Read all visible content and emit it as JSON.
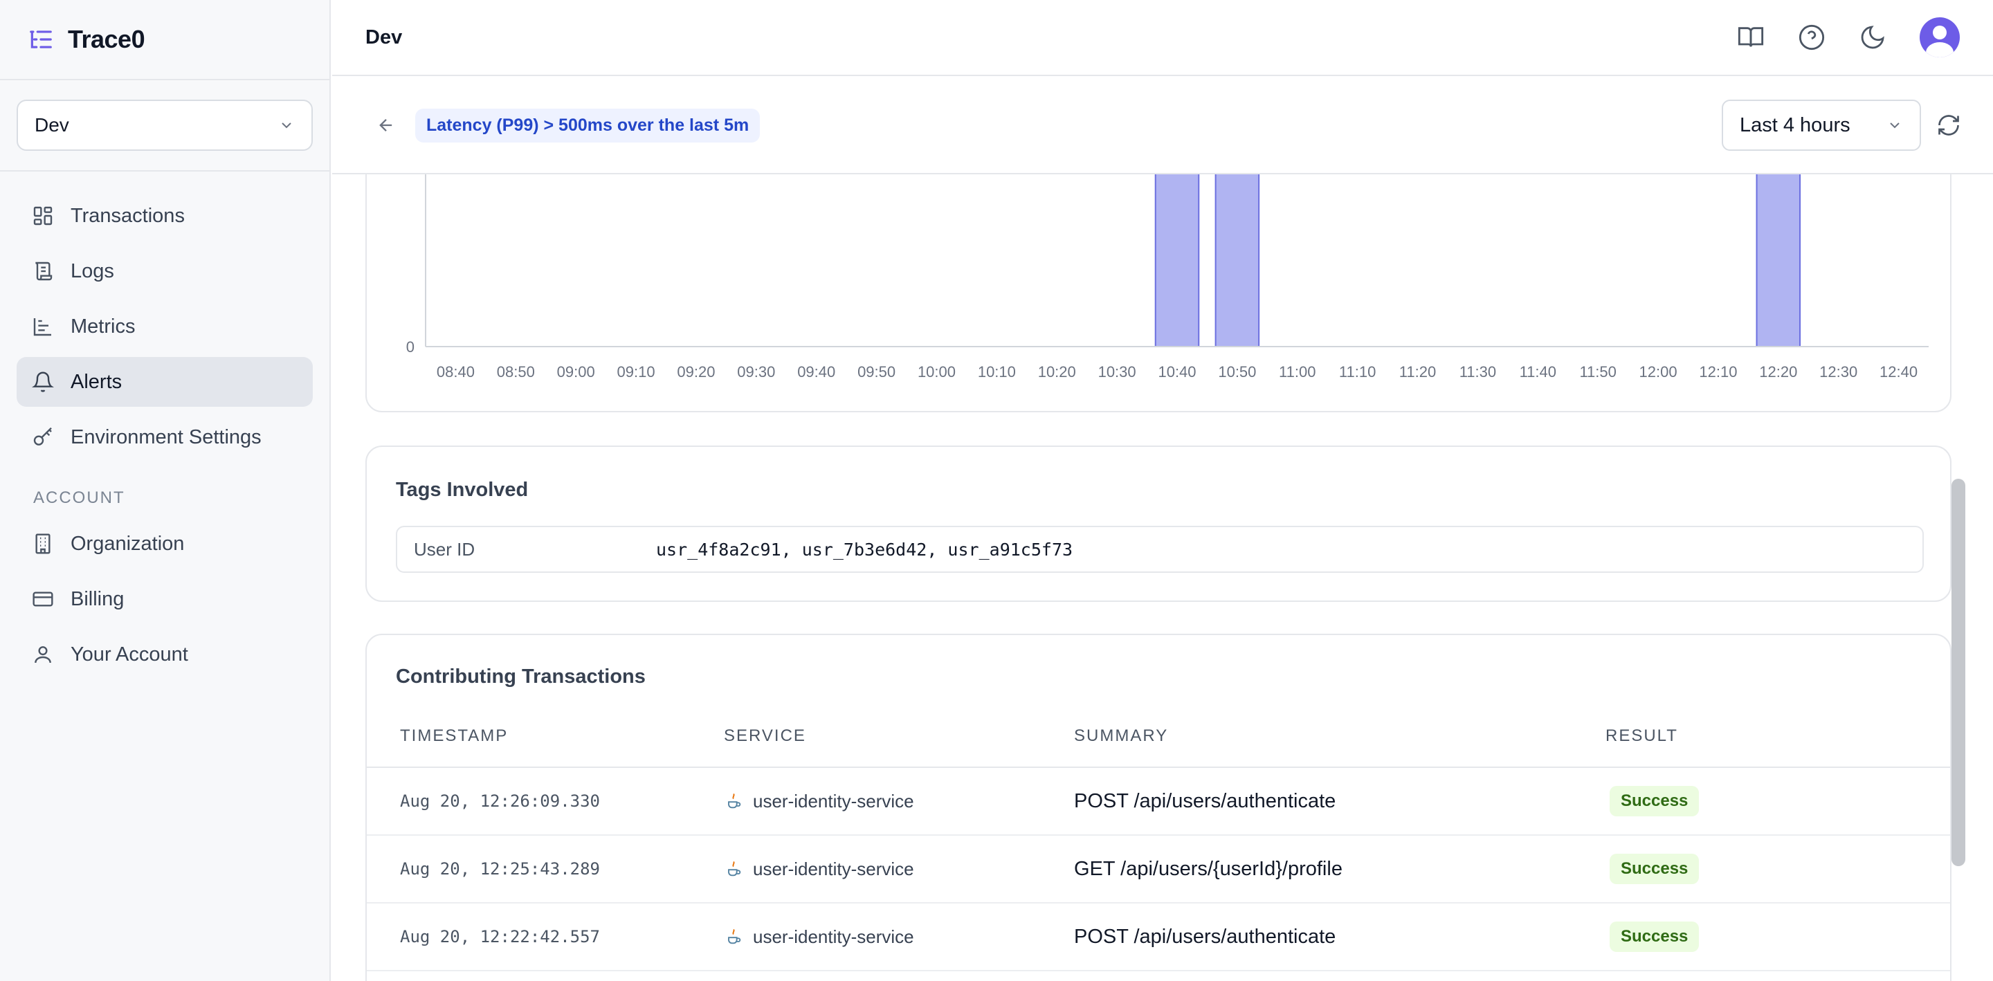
{
  "app": {
    "name": "Trace0"
  },
  "environment": {
    "selected": "Dev"
  },
  "sidebar": {
    "items": [
      {
        "label": "Transactions",
        "icon": "dashboard-icon"
      },
      {
        "label": "Logs",
        "icon": "scroll-icon"
      },
      {
        "label": "Metrics",
        "icon": "bar-chart-icon"
      },
      {
        "label": "Alerts",
        "icon": "bell-icon",
        "active": true
      },
      {
        "label": "Environment Settings",
        "icon": "key-icon"
      }
    ],
    "account_label": "ACCOUNT",
    "account_items": [
      {
        "label": "Organization",
        "icon": "building-icon"
      },
      {
        "label": "Billing",
        "icon": "credit-card-icon"
      },
      {
        "label": "Your Account",
        "icon": "user-icon"
      }
    ]
  },
  "header": {
    "title": "Dev",
    "icons": [
      "book-icon",
      "help-icon",
      "moon-icon",
      "avatar"
    ]
  },
  "alert": {
    "condition": "Latency (P99) > 500ms over the last 5m"
  },
  "time_range": {
    "selected": "Last 4 hours"
  },
  "chart_data": {
    "type": "bar",
    "categories": [
      "08:40",
      "08:50",
      "09:00",
      "09:10",
      "09:20",
      "09:30",
      "09:40",
      "09:50",
      "10:00",
      "10:10",
      "10:20",
      "10:30",
      "10:40",
      "10:50",
      "11:00",
      "11:10",
      "11:20",
      "11:30",
      "11:40",
      "11:50",
      "12:00",
      "12:10",
      "12:20",
      "12:30",
      "12:40"
    ],
    "y_tick_visible": "0",
    "bars": [
      {
        "x": "10:40",
        "value": 1
      },
      {
        "x": "10:50",
        "value": 1
      },
      {
        "x": "12:20",
        "value": 1
      }
    ],
    "bar_color": "#b0b4f2",
    "bar_stroke": "#6b6fe0"
  },
  "tags": {
    "title": "Tags Involved",
    "rows": [
      {
        "key": "User ID",
        "value": "usr_4f8a2c91, usr_7b3e6d42, usr_a91c5f73"
      }
    ]
  },
  "transactions": {
    "title": "Contributing Transactions",
    "columns": [
      "TIMESTAMP",
      "SERVICE",
      "SUMMARY",
      "RESULT"
    ],
    "rows": [
      {
        "timestamp": "Aug 20, 12:26:09.330",
        "service": "user-identity-service",
        "summary": "POST /api/users/authenticate",
        "result": "Success"
      },
      {
        "timestamp": "Aug 20, 12:25:43.289",
        "service": "user-identity-service",
        "summary": "GET /api/users/{userId}/profile",
        "result": "Success"
      },
      {
        "timestamp": "Aug 20, 12:22:42.557",
        "service": "user-identity-service",
        "summary": "POST /api/users/authenticate",
        "result": "Success"
      }
    ]
  }
}
